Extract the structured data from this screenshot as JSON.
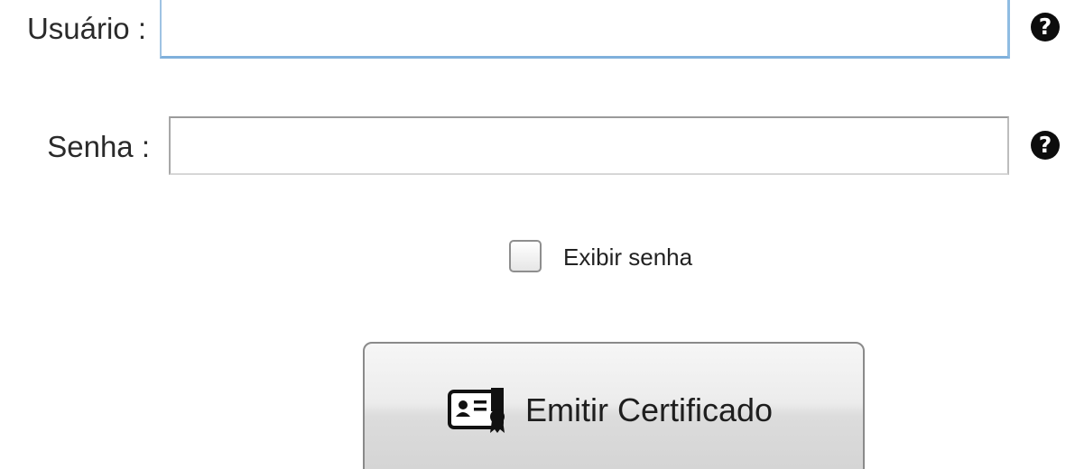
{
  "form": {
    "usuario": {
      "label": "Usuário :",
      "value": "",
      "help_icon": "question-circle-icon"
    },
    "senha": {
      "label": "Senha :",
      "value": "",
      "help_icon": "question-circle-icon"
    },
    "show_password": {
      "label": "Exibir senha",
      "checked": false
    },
    "emit_button": {
      "label": "Emitir Certificado",
      "icon": "certificate-icon"
    }
  },
  "colors": {
    "focus_border": "#7fb0dc",
    "help_icon_bg": "#0d0d0d",
    "button_bg_top": "#f6f6f6",
    "button_bg_bottom": "#d4d4d4"
  }
}
